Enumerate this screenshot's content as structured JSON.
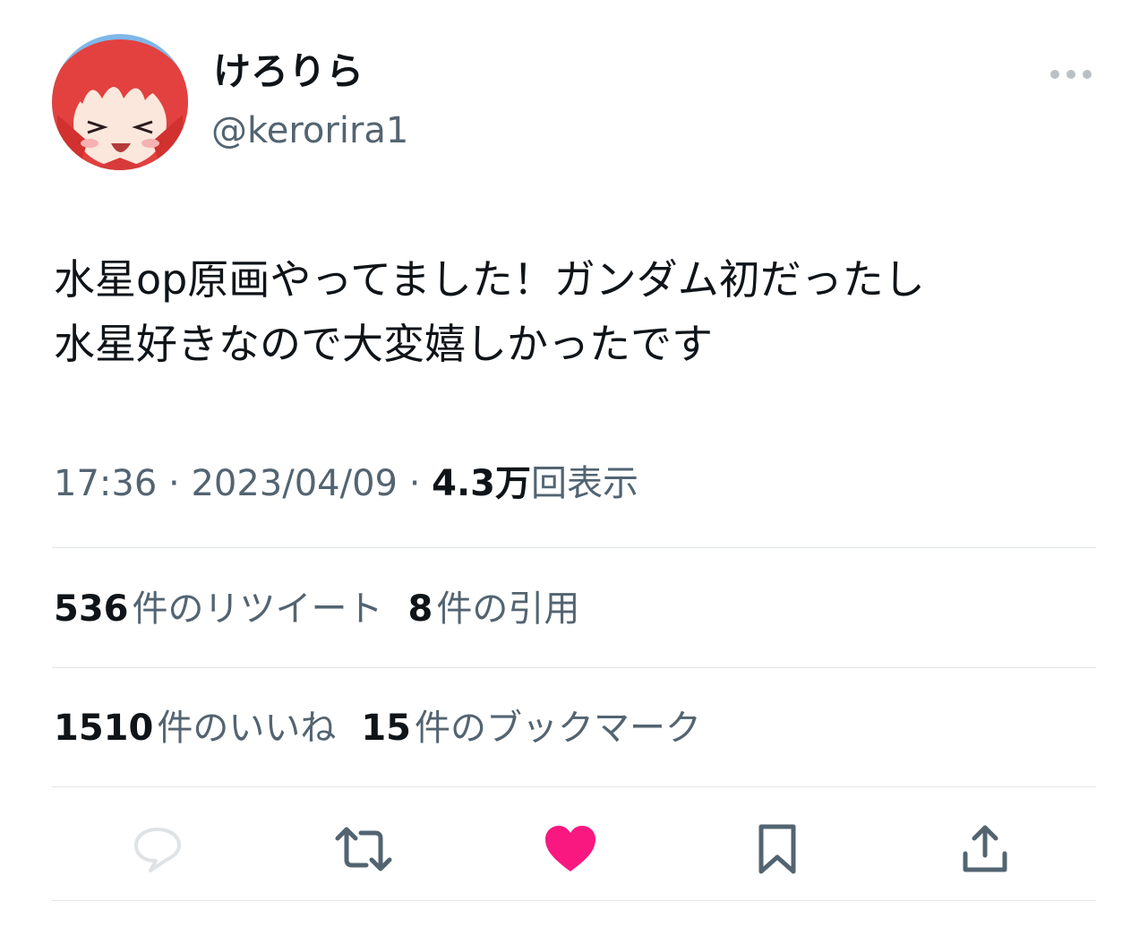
{
  "user": {
    "display_name": "けろりら",
    "handle": "@kerorira1"
  },
  "tweet": {
    "lines": [
      "水星op原画やってました！ガンダム初だったし",
      "水星好きなので大変嬉しかったです"
    ],
    "time": "17:36",
    "sep1": " · ",
    "date": "2023/04/09",
    "sep2": " · ",
    "views_count": "4.3万",
    "views_label": "回表示"
  },
  "stats": {
    "retweets_count": "536",
    "retweets_label": "件のリツイート",
    "quotes_count": "8",
    "quotes_label": "件の引用",
    "likes_count": "1510",
    "likes_label": "件のいいね",
    "bookmarks_count": "15",
    "bookmarks_label": "件のブックマーク"
  },
  "actions": [
    {
      "name": "reply",
      "icon": "reply-icon",
      "active": false
    },
    {
      "name": "retweet",
      "icon": "retweet-icon",
      "active": false
    },
    {
      "name": "like",
      "icon": "heart-icon",
      "active": true
    },
    {
      "name": "bookmark",
      "icon": "bookmark-icon",
      "active": false
    },
    {
      "name": "share",
      "icon": "share-icon",
      "active": false
    }
  ],
  "colors": {
    "text_primary": "#0f1419",
    "text_secondary": "#536471",
    "like_active": "#f91880",
    "divider": "#e3e6e8"
  }
}
